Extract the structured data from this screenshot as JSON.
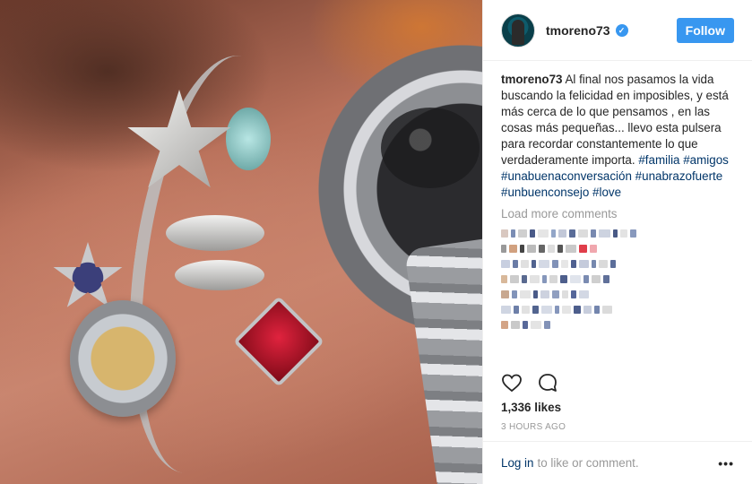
{
  "post": {
    "username": "tmoreno73",
    "verified": true,
    "follow_label": "Follow",
    "caption": {
      "user": "tmoreno73",
      "text": "Al final nos pasamos la vida buscando la felicidad en imposibles, y está más cerca de lo que pensamos , en las cosas más pequeñas... llevo esta pulsera para recordar constantemente lo que verdaderamente importa.",
      "hashtags": [
        "#familia",
        "#amigos",
        "#unabuenaconversación",
        "#unabrazofuerte",
        "#unbuenconsejo",
        "#love"
      ]
    },
    "load_more_label": "Load more comments",
    "likes": "1,336 likes",
    "time_ago": "3 HOURS AGO",
    "footer": {
      "login_label": "Log in",
      "rest_label": "to like or comment.",
      "more_label": "•••"
    }
  },
  "icons": {
    "verified": "verified-badge-icon",
    "like": "heart-outline-icon",
    "comment": "comment-bubble-icon",
    "more": "more-options-icon"
  },
  "colors": {
    "accent": "#3897f0",
    "link": "#003569",
    "muted": "#999999",
    "text": "#262626"
  }
}
